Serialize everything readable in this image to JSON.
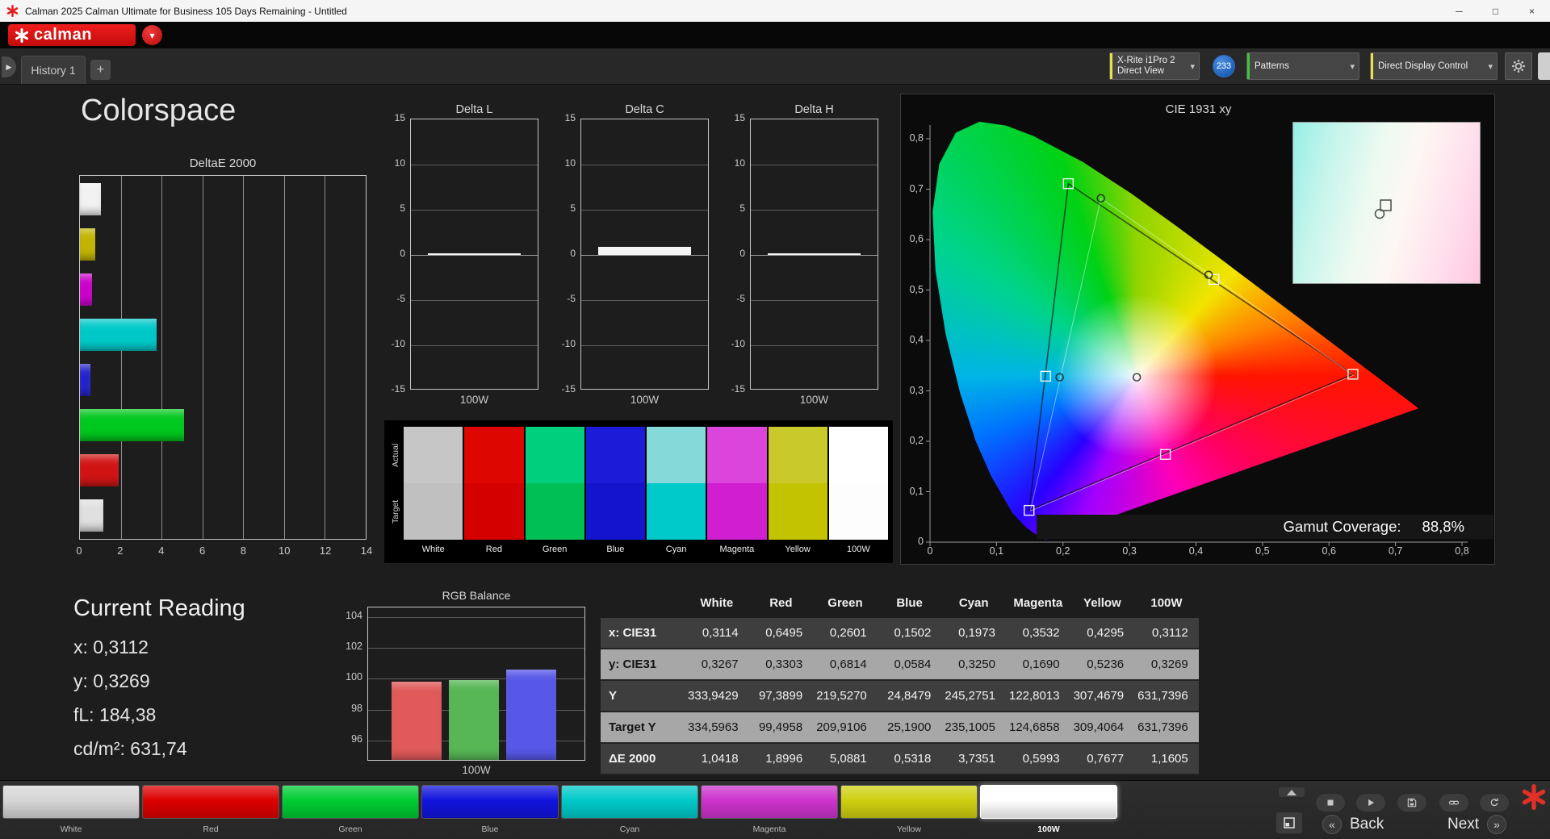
{
  "window": {
    "title": "Calman 2025 Calman Ultimate for Business 105 Days Remaining  - Untitled",
    "controls": {
      "minimize": "─",
      "maximize": "□",
      "close": "×"
    }
  },
  "brand": {
    "name": "calman"
  },
  "tab_bar": {
    "tabs": [
      {
        "label": "History 1"
      }
    ],
    "add_label": "+",
    "scroll_icon": "▶"
  },
  "top_controls": {
    "meter": {
      "line1": "X-Rite i1Pro 2",
      "line2": "Direct View",
      "accent": "#e8e24a",
      "chevron": "▾"
    },
    "badge": {
      "text": "233",
      "color": "#1560c0"
    },
    "patterns": {
      "label": "Patterns",
      "accent": "#3fc43f",
      "chevron": "▾"
    },
    "display_control": {
      "label": "Direct Display Control",
      "accent": "#e8e24a",
      "chevron": "▾"
    }
  },
  "page": {
    "title": "Colorspace"
  },
  "deltae_chart": {
    "title": "DeltaE 2000",
    "xticks": [
      "0",
      "2",
      "4",
      "6",
      "8",
      "10",
      "12",
      "14"
    ],
    "xmax": 14,
    "bars": [
      {
        "name": "White",
        "value": 1.04,
        "color": "#f2f2f2"
      },
      {
        "name": "Yellow",
        "value": 0.77,
        "color": "#c3b400"
      },
      {
        "name": "Magenta",
        "value": 0.6,
        "color": "#cc00cc"
      },
      {
        "name": "Cyan",
        "value": 3.74,
        "color": "#00c8c8"
      },
      {
        "name": "Blue",
        "value": 0.53,
        "color": "#2424cc"
      },
      {
        "name": "Green",
        "value": 5.09,
        "color": "#00c81e"
      },
      {
        "name": "Red",
        "value": 1.9,
        "color": "#d01414"
      },
      {
        "name": "100W",
        "value": 1.16,
        "color": "#e0e0e0"
      }
    ]
  },
  "delta_charts": [
    {
      "title": "Delta L",
      "value": 0.1,
      "xlabel": "100W",
      "yticks": [
        "15",
        "10",
        "5",
        "0",
        "-5",
        "-10",
        "-15"
      ]
    },
    {
      "title": "Delta C",
      "value": 0.85,
      "xlabel": "100W",
      "yticks": [
        "15",
        "10",
        "5",
        "0",
        "-5",
        "-10",
        "-15"
      ]
    },
    {
      "title": "Delta H",
      "value": 0.05,
      "xlabel": "100W",
      "yticks": [
        "15",
        "10",
        "5",
        "0",
        "-5",
        "-10",
        "-15"
      ]
    }
  ],
  "swatches": {
    "row_labels": [
      "Actual",
      "Target"
    ],
    "columns": [
      {
        "label": "White",
        "actual": "#c6c6c6",
        "target": "#c0c0c0"
      },
      {
        "label": "Red",
        "actual": "#dd0600",
        "target": "#d40000"
      },
      {
        "label": "Green",
        "actual": "#00cf7e",
        "target": "#00bf55"
      },
      {
        "label": "Blue",
        "actual": "#1b1bd8",
        "target": "#1414cc"
      },
      {
        "label": "Cyan",
        "actual": "#86d9d9",
        "target": "#00c9c9"
      },
      {
        "label": "Magenta",
        "actual": "#dc45dc",
        "target": "#d01ed0"
      },
      {
        "label": "Yellow",
        "actual": "#c9c92c",
        "target": "#c3c300"
      },
      {
        "label": "100W",
        "actual": "#ffffff",
        "target": "#fdfdfd"
      }
    ]
  },
  "cie_chart": {
    "title": "CIE 1931 xy",
    "xticks": [
      "0",
      "0,1",
      "0,2",
      "0,3",
      "0,4",
      "0,5",
      "0,6",
      "0,7",
      "0,8"
    ],
    "yticks": [
      "0,8",
      "0,7",
      "0,6",
      "0,5",
      "0,4",
      "0,3",
      "0,2",
      "0,1",
      "0"
    ],
    "gamut_coverage_label": "Gamut Coverage:",
    "gamut_coverage_value": "88,8%",
    "triangle": {
      "red": [
        0.636,
        0.333
      ],
      "green": [
        0.208,
        0.711
      ],
      "blue": [
        0.149,
        0.063
      ]
    },
    "measured_triangle": {
      "red": [
        0.637,
        0.331
      ],
      "green": [
        0.257,
        0.682
      ],
      "blue": [
        0.151,
        0.062
      ]
    },
    "target_points": [
      [
        0.31,
        0.329
      ],
      [
        0.174,
        0.329
      ],
      [
        0.354,
        0.174
      ],
      [
        0.427,
        0.521
      ],
      [
        0.208,
        0.711
      ],
      [
        0.636,
        0.333
      ],
      [
        0.149,
        0.063
      ]
    ],
    "measured_points": [
      [
        0.257,
        0.682
      ],
      [
        0.419,
        0.53
      ],
      [
        0.195,
        0.327
      ],
      [
        0.311,
        0.327
      ]
    ]
  },
  "current_reading": {
    "title": "Current Reading",
    "lines": [
      "x: 0,3112",
      "y: 0,3269",
      "fL: 184,38",
      "cd/m²: 631,74"
    ]
  },
  "rgb_balance": {
    "title": "RGB Balance",
    "yticks": [
      "104",
      "102",
      "100",
      "98",
      "96"
    ],
    "xlabel": "100W",
    "bars": [
      {
        "name": "Red",
        "value": 99.8,
        "color": "#e05a5a"
      },
      {
        "name": "Green",
        "value": 99.9,
        "color": "#57b757"
      },
      {
        "name": "Blue",
        "value": 100.6,
        "color": "#5858e8"
      }
    ]
  },
  "table": {
    "columns": [
      "White",
      "Red",
      "Green",
      "Blue",
      "Cyan",
      "Magenta",
      "Yellow",
      "100W"
    ],
    "rows": [
      {
        "label": "x: CIE31",
        "light": false,
        "values": [
          "0,3114",
          "0,6495",
          "0,2601",
          "0,1502",
          "0,1973",
          "0,3532",
          "0,4295",
          "0,3112"
        ]
      },
      {
        "label": "y: CIE31",
        "light": true,
        "values": [
          "0,3267",
          "0,3303",
          "0,6814",
          "0,0584",
          "0,3250",
          "0,1690",
          "0,5236",
          "0,3269"
        ]
      },
      {
        "label": "Y",
        "light": false,
        "values": [
          "333,9429",
          "97,3899",
          "219,5270",
          "24,8479",
          "245,2751",
          "122,8013",
          "307,4679",
          "631,7396"
        ]
      },
      {
        "label": "Target Y",
        "light": true,
        "values": [
          "334,5963",
          "99,4958",
          "209,9106",
          "25,1900",
          "235,1005",
          "124,6858",
          "309,4064",
          "631,7396"
        ]
      },
      {
        "label": "ΔE 2000",
        "light": false,
        "values": [
          "1,0418",
          "1,8996",
          "5,0881",
          "0,5318",
          "3,7351",
          "0,5993",
          "0,7677",
          "1,1605"
        ]
      }
    ]
  },
  "bottom_bar": {
    "swatches": [
      {
        "label": "White",
        "color": "#d6d6d6",
        "selected": false
      },
      {
        "label": "Red",
        "color": "#dd0000",
        "selected": false
      },
      {
        "label": "Green",
        "color": "#00cc33",
        "selected": false
      },
      {
        "label": "Blue",
        "color": "#1113dd",
        "selected": false
      },
      {
        "label": "Cyan",
        "color": "#00c9c9",
        "selected": false
      },
      {
        "label": "Magenta",
        "color": "#cc33cc",
        "selected": false
      },
      {
        "label": "Yellow",
        "color": "#cfcf11",
        "selected": false
      },
      {
        "label": "100W",
        "color": "#ffffff",
        "selected": true
      }
    ],
    "back_label": "Back",
    "next_label": "Next",
    "back_chevron": "«",
    "next_chevron": "»"
  },
  "icons": {
    "window": [
      "minimize",
      "maximize",
      "close"
    ],
    "transport": [
      "eject",
      "stop",
      "play",
      "save",
      "link",
      "refresh"
    ],
    "misc": [
      "gear",
      "layout-grid",
      "calman-asterisk",
      "dropdown-chevron"
    ]
  },
  "chart_data": [
    {
      "type": "bar",
      "title": "DeltaE 2000",
      "orientation": "horizontal",
      "categories": [
        "White",
        "Yellow",
        "Magenta",
        "Cyan",
        "Blue",
        "Green",
        "Red",
        "100W"
      ],
      "values": [
        1.04,
        0.77,
        0.6,
        3.74,
        0.53,
        5.09,
        1.9,
        1.16
      ],
      "xlim": [
        0,
        14
      ],
      "xticks": [
        0,
        2,
        4,
        6,
        8,
        10,
        12,
        14
      ],
      "grid": true
    },
    {
      "type": "bar",
      "title": "Delta L",
      "categories": [
        "100W"
      ],
      "values": [
        0.1
      ],
      "ylim": [
        -15,
        15
      ]
    },
    {
      "type": "bar",
      "title": "Delta C",
      "categories": [
        "100W"
      ],
      "values": [
        0.85
      ],
      "ylim": [
        -15,
        15
      ]
    },
    {
      "type": "bar",
      "title": "Delta H",
      "categories": [
        "100W"
      ],
      "values": [
        0.05
      ],
      "ylim": [
        -15,
        15
      ]
    },
    {
      "type": "bar",
      "title": "RGB Balance",
      "categories": [
        "Red",
        "Green",
        "Blue"
      ],
      "values": [
        99.8,
        99.9,
        100.6
      ],
      "ylim": [
        94.8,
        104.6
      ],
      "yticks": [
        96,
        98,
        100,
        102,
        104
      ],
      "xlabel": "100W"
    },
    {
      "type": "scatter",
      "title": "CIE 1931 xy",
      "xlim": [
        0,
        0.8
      ],
      "ylim": [
        0,
        0.85
      ],
      "gamut_triangle": {
        "red": [
          0.636,
          0.333
        ],
        "green": [
          0.208,
          0.711
        ],
        "blue": [
          0.149,
          0.063
        ]
      },
      "target_points": [
        [
          0.31,
          0.329
        ],
        [
          0.174,
          0.329
        ],
        [
          0.354,
          0.174
        ],
        [
          0.427,
          0.521
        ],
        [
          0.208,
          0.711
        ],
        [
          0.636,
          0.333
        ],
        [
          0.149,
          0.063
        ]
      ],
      "measured_points": [
        [
          0.257,
          0.682
        ],
        [
          0.419,
          0.53
        ],
        [
          0.195,
          0.327
        ],
        [
          0.311,
          0.327
        ]
      ],
      "annotation": "Gamut Coverage: 88,8%"
    }
  ]
}
